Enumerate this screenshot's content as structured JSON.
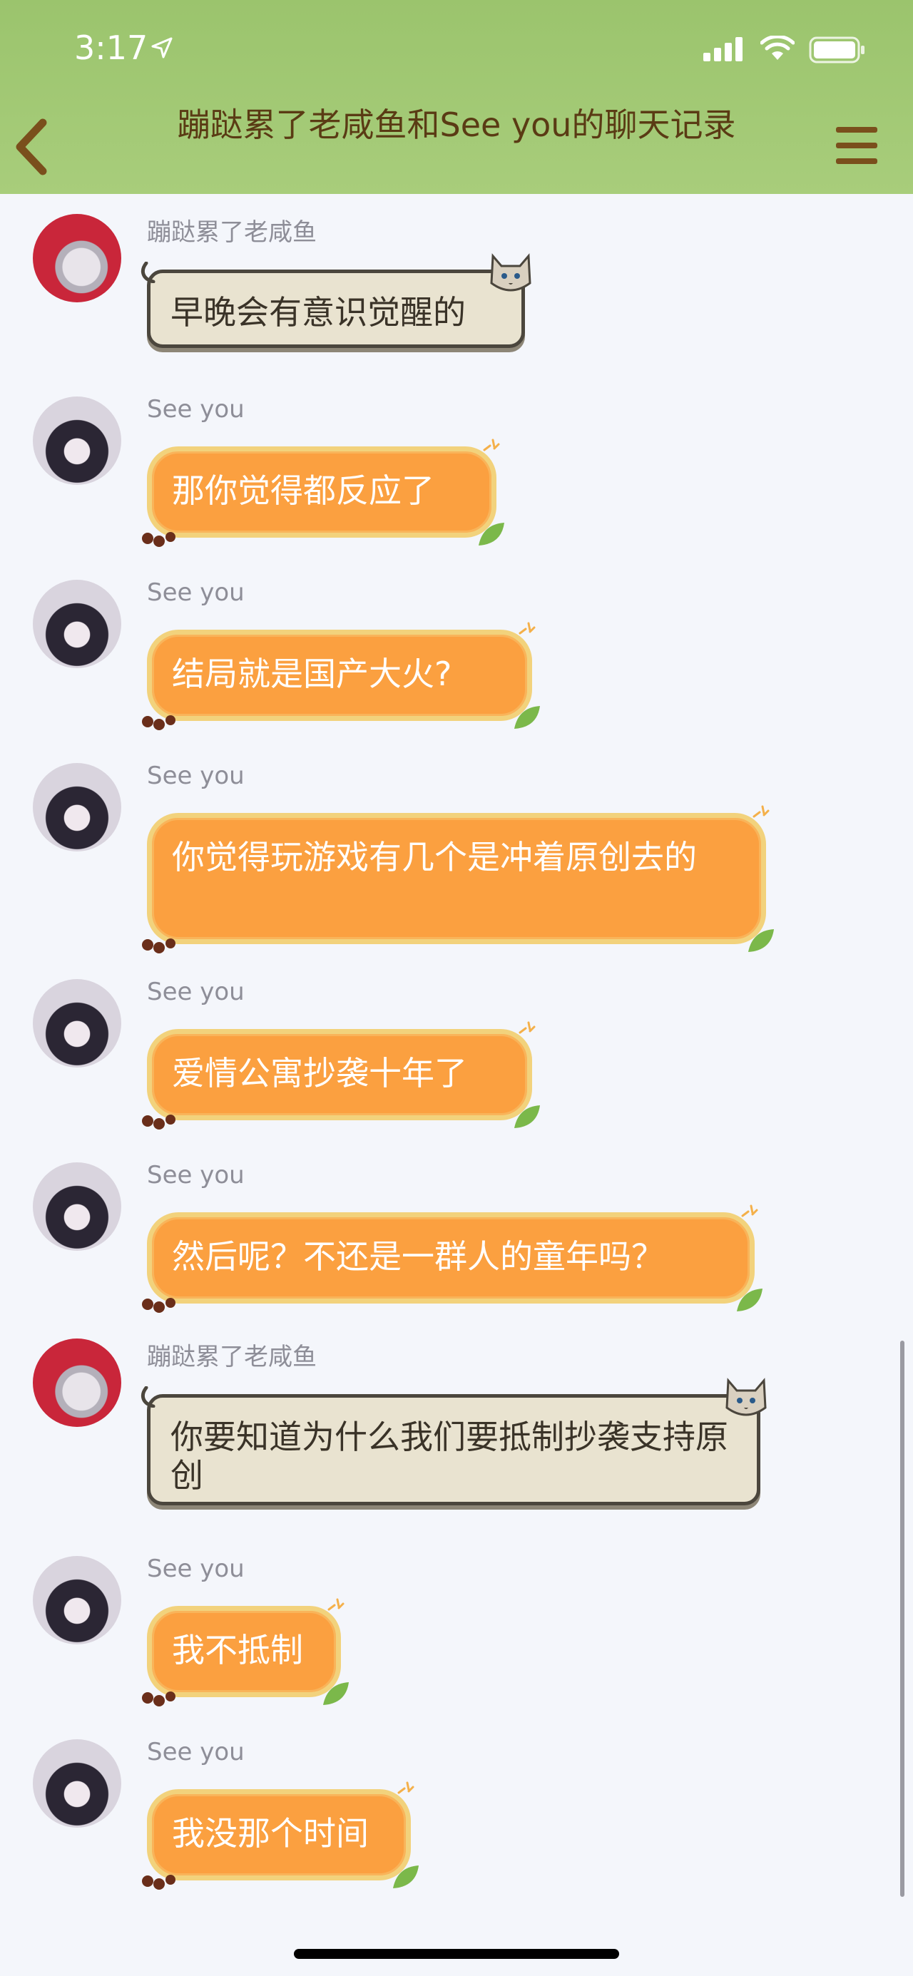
{
  "status": {
    "time": "3:17"
  },
  "header": {
    "title": "蹦跶累了老咸鱼和See you的聊天记录"
  },
  "icons": {
    "back": "back-chevron-icon",
    "menu": "hamburger-menu-icon",
    "signal": "signal-icon",
    "wifi": "wifi-icon",
    "battery": "battery-icon",
    "location": "location-arrow-icon"
  },
  "colors": {
    "header_bg": "#a3c975",
    "title": "#5a3b14",
    "bubble_orange": "#fba040",
    "bubble_cream": "#e9e3d0",
    "sender": "#8e8e98",
    "background": "#f4f6fb"
  },
  "messages": [
    {
      "sender": "蹦跶累了老咸鱼",
      "text": "早晚会有意识觉醒的",
      "style": "cream"
    },
    {
      "sender": "See you",
      "text": "那你觉得都反应了",
      "style": "orange"
    },
    {
      "sender": "See you",
      "text": "结局就是国产大火?",
      "style": "orange"
    },
    {
      "sender": "See you",
      "text": "你觉得玩游戏有几个是冲着原创去的",
      "style": "orange"
    },
    {
      "sender": "See you",
      "text": "爱情公寓抄袭十年了",
      "style": "orange"
    },
    {
      "sender": "See you",
      "text": "然后呢？不还是一群人的童年吗？",
      "style": "orange"
    },
    {
      "sender": "蹦跶累了老咸鱼",
      "text": "你要知道为什么我们要抵制抄袭支持原创",
      "style": "cream"
    },
    {
      "sender": "See you",
      "text": "我不抵制",
      "style": "orange"
    },
    {
      "sender": "See you",
      "text": "我没那个时间",
      "style": "orange"
    }
  ]
}
